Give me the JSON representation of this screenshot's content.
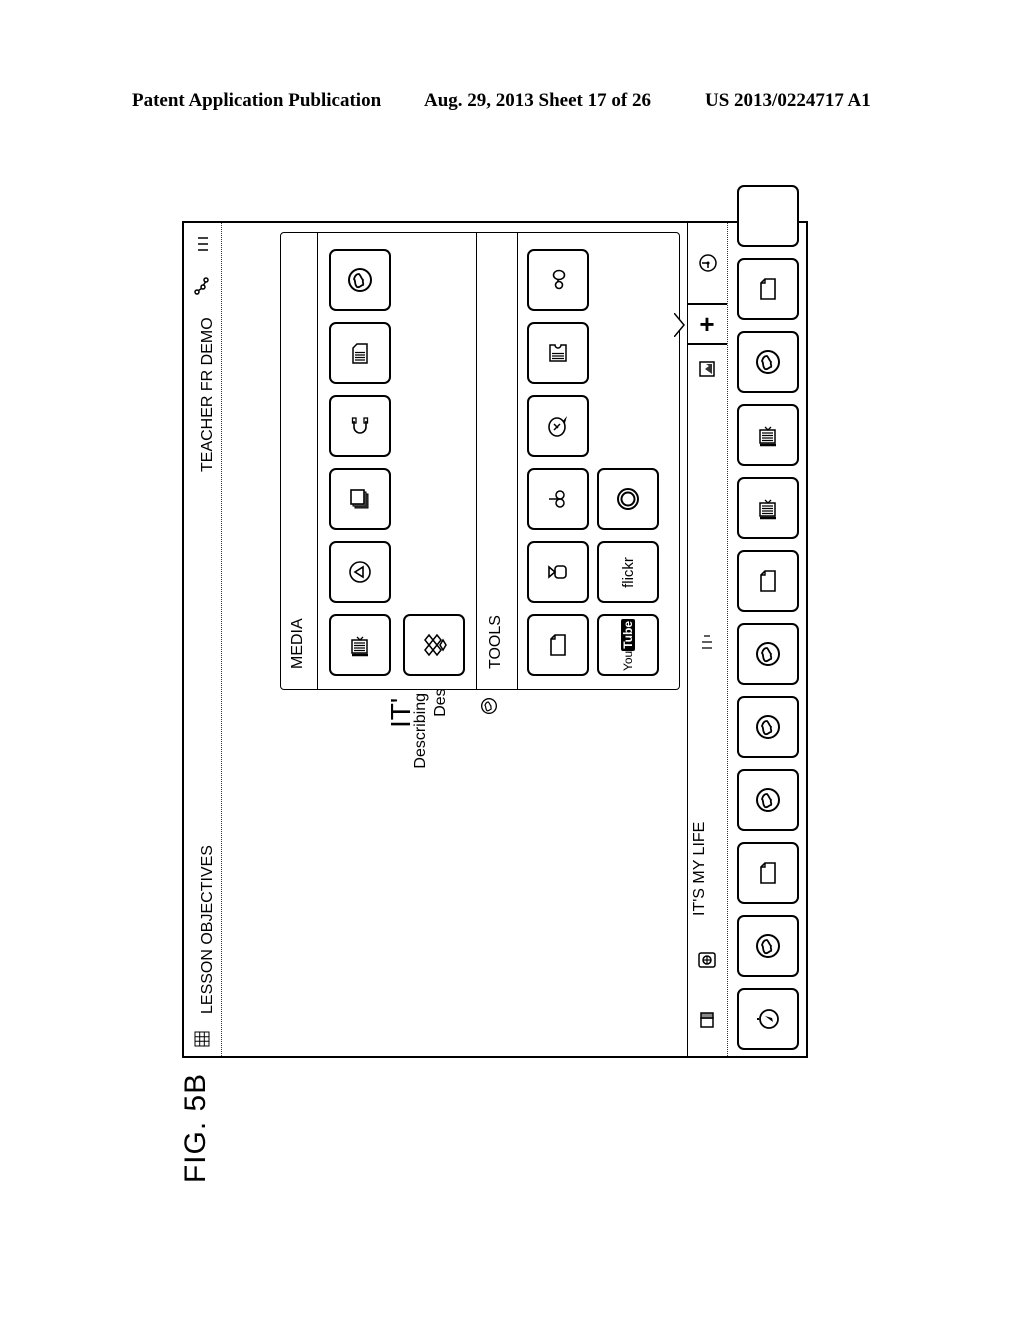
{
  "patent_header": {
    "publication": "Patent Application Publication",
    "date_sheet": "Aug. 29, 2013  Sheet 17 of 26",
    "number": "US 2013/0224717 A1"
  },
  "figure_label": "FIG. 5B",
  "top_bar": {
    "grid_icon": "grid-icon",
    "section_title": "LESSON OBJECTIVES",
    "user_title": "TEACHER FR DEMO",
    "share_icon": "connections-icon",
    "menu_icon": "menu-icon"
  },
  "content": {
    "heading_partial": "IT'",
    "line1_partial": "Describing",
    "line2_partial": "Descr",
    "item_icon": "globe-icon"
  },
  "popup": {
    "media_label": "MEDIA",
    "tools_label": "TOOLS",
    "media_items": [
      {
        "icon": "presentation-icon"
      },
      {
        "icon": "dropbox-icon"
      },
      {
        "icon": "play-circle-icon"
      },
      {
        "icon": "gallery-icon"
      },
      {
        "icon": "headphones-icon"
      },
      {
        "icon": "document-lines-icon"
      },
      {
        "icon": "globe-icon"
      }
    ],
    "tools_items": [
      {
        "icon": "blank-page-icon"
      },
      {
        "icon": "youtube-icon",
        "text_you": "You",
        "text_tube": "Tube"
      },
      {
        "icon": "camera-icon"
      },
      {
        "icon": "flickr-icon",
        "text": "flickr"
      },
      {
        "icon": "link-icon"
      },
      {
        "icon": "record-circle-icon"
      },
      {
        "icon": "chat-bubble-icon"
      },
      {
        "icon": "notepad-icon"
      },
      {
        "icon": "glasses-icon"
      }
    ]
  },
  "toolbar": {
    "left_icon": "stack-icon",
    "lesson_icon": "lesson-badge-icon",
    "lesson_title": "IT'S MY LIFE",
    "list_icon": "list-icon",
    "export_icon": "export-icon",
    "add_label": "+",
    "timer_icon": "timer-icon"
  },
  "slide_strip": [
    {
      "icon": "compass-icon"
    },
    {
      "icon": "globe-icon"
    },
    {
      "icon": "blank-page-icon"
    },
    {
      "icon": "globe-icon"
    },
    {
      "icon": "globe-icon"
    },
    {
      "icon": "globe-icon"
    },
    {
      "icon": "blank-page-icon"
    },
    {
      "icon": "presentation-icon"
    },
    {
      "icon": "presentation-icon"
    },
    {
      "icon": "globe-icon"
    },
    {
      "icon": "blank-page-icon"
    }
  ]
}
